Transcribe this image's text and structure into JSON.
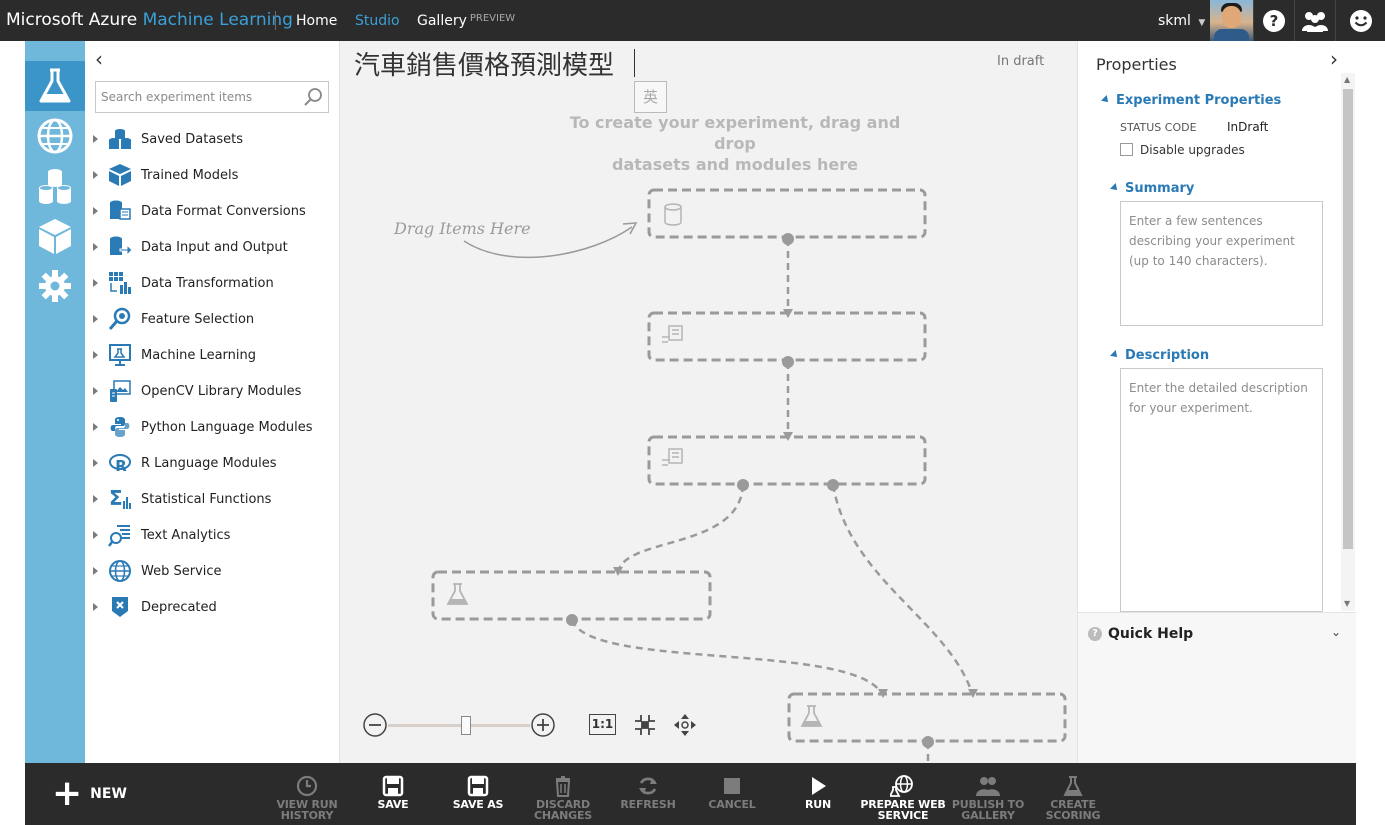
{
  "topbar": {
    "brand_main": "Microsoft Azure",
    "brand_accent": "Machine Learning",
    "nav_home": "Home",
    "nav_studio": "Studio",
    "nav_gallery": "Gallery",
    "nav_gallery_badge": "PREVIEW",
    "user_name": "skml",
    "icons": [
      "help-icon",
      "community-icon",
      "feedback-icon"
    ]
  },
  "rail": {
    "items": [
      "experiments-icon",
      "web-services-icon",
      "datasets-icon",
      "trained-models-icon",
      "settings-icon"
    ],
    "active": "experiments-icon"
  },
  "palette": {
    "search_placeholder": "Search experiment items",
    "items": [
      {
        "label": "Saved Datasets",
        "icon": "datasets-icon"
      },
      {
        "label": "Trained Models",
        "icon": "cube-icon"
      },
      {
        "label": "Data Format Conversions",
        "icon": "format-conversion-icon"
      },
      {
        "label": "Data Input and Output",
        "icon": "data-io-icon"
      },
      {
        "label": "Data Transformation",
        "icon": "transformation-icon"
      },
      {
        "label": "Feature Selection",
        "icon": "magnifier-icon"
      },
      {
        "label": "Machine Learning",
        "icon": "ml-board-icon"
      },
      {
        "label": "OpenCV Library Modules",
        "icon": "opencv-icon"
      },
      {
        "label": "Python Language Modules",
        "icon": "python-icon"
      },
      {
        "label": "R Language Modules",
        "icon": "r-language-icon"
      },
      {
        "label": "Statistical Functions",
        "icon": "sigma-icon"
      },
      {
        "label": "Text Analytics",
        "icon": "text-analytics-icon"
      },
      {
        "label": "Web Service",
        "icon": "globe-icon"
      },
      {
        "label": "Deprecated",
        "icon": "deprecated-icon"
      }
    ]
  },
  "canvas": {
    "title": "汽車銷售價格預測模型",
    "status": "In draft",
    "ime_char": "英",
    "hint_line1": "To create your experiment, drag and drop",
    "hint_line2": "datasets and modules here",
    "drag_note": "Drag Items Here",
    "zoom_level": 0.55,
    "fit_label": "1:1"
  },
  "properties": {
    "title": "Properties",
    "experiment_properties_label": "Experiment Properties",
    "status_code_key": "STATUS CODE",
    "status_code_value": "InDraft",
    "disable_upgrades_label": "Disable upgrades",
    "summary_label": "Summary",
    "summary_placeholder": "Enter a few sentences describing your experiment (up to 140 characters).",
    "description_label": "Description",
    "description_placeholder": "Enter the detailed description for your experiment.",
    "quick_help_label": "Quick Help"
  },
  "toolbar": {
    "new_label": "NEW",
    "tools": [
      {
        "line1": "VIEW RUN",
        "line2": "HISTORY",
        "enabled": false,
        "icon": "history-icon"
      },
      {
        "line1": "SAVE",
        "line2": "",
        "enabled": true,
        "icon": "save-icon"
      },
      {
        "line1": "SAVE AS",
        "line2": "",
        "enabled": true,
        "icon": "save-as-icon"
      },
      {
        "line1": "DISCARD",
        "line2": "CHANGES",
        "enabled": false,
        "icon": "trash-icon"
      },
      {
        "line1": "REFRESH",
        "line2": "",
        "enabled": false,
        "icon": "refresh-icon"
      },
      {
        "line1": "CANCEL",
        "line2": "",
        "enabled": false,
        "icon": "stop-icon"
      },
      {
        "line1": "RUN",
        "line2": "",
        "enabled": true,
        "icon": "play-icon"
      },
      {
        "line1": "PREPARE WEB",
        "line2": "SERVICE",
        "enabled": true,
        "icon": "web-service-setup-icon"
      },
      {
        "line1": "PUBLISH TO",
        "line2": "GALLERY",
        "enabled": false,
        "icon": "publish-gallery-icon"
      },
      {
        "line1": "CREATE",
        "line2": "SCORING",
        "enabled": false,
        "icon": "scoring-flask-icon"
      }
    ]
  },
  "colors": {
    "topbar_bg": "#2b2b2b",
    "accent_blue": "#3aa0d8",
    "rail_bg": "#70b8db",
    "rail_active": "#3b95c8",
    "canvas_bg": "#f2f2f2",
    "section_blue": "#2a7ab5"
  }
}
